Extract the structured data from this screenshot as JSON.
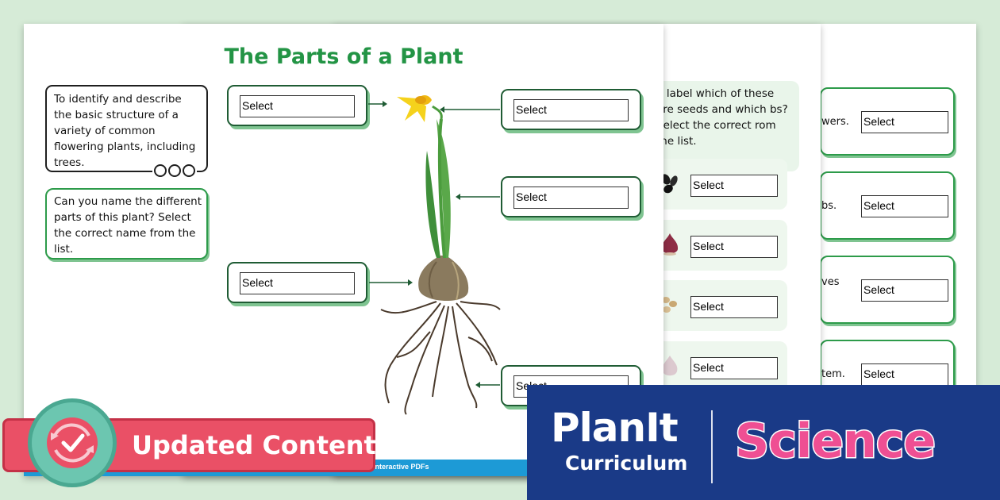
{
  "worksheet3": {
    "rows": [
      {
        "text": "wers.",
        "select": "Select"
      },
      {
        "text": "bs.",
        "select": "Select"
      },
      {
        "text": "ves",
        "select": "Select"
      },
      {
        "text": "tem.",
        "select": "Select"
      }
    ]
  },
  "worksheet2": {
    "question": "u label which of these are seeds and which bs? Select the correct rom the list.",
    "cards": [
      {
        "image": "black-seeds-icon",
        "select": "Select"
      },
      {
        "image": "red-bulb-icon",
        "select": "Select"
      },
      {
        "image": "beige-seeds-icon",
        "select": "Select"
      },
      {
        "image": "garlic-bulb-icon",
        "select": "Select"
      }
    ]
  },
  "worksheet1": {
    "title": "The Parts of a Plant",
    "objective": "To identify and describe the basic structure of a variety of common flowering plants, including trees.",
    "instruction": "Can you name the different parts of this plant? Select the correct name from the list.",
    "selects": {
      "top_left": "Select",
      "middle_left": "Select",
      "top_right": "Select",
      "middle_right": "Select",
      "bottom_right": "Select"
    },
    "footer_text": "Interactive PDFs"
  },
  "banner": {
    "label": "Updated Content!"
  },
  "brand": {
    "planit": "PlanIt",
    "curriculum": "Curriculum",
    "subject": "Science"
  },
  "colors": {
    "background": "#d6ebd7",
    "title_green": "#239445",
    "banner_red": "#ea5066",
    "brand_navy": "#1a3a87",
    "science_pink": "#ef4f93",
    "badge_teal": "#6cc6b0"
  }
}
